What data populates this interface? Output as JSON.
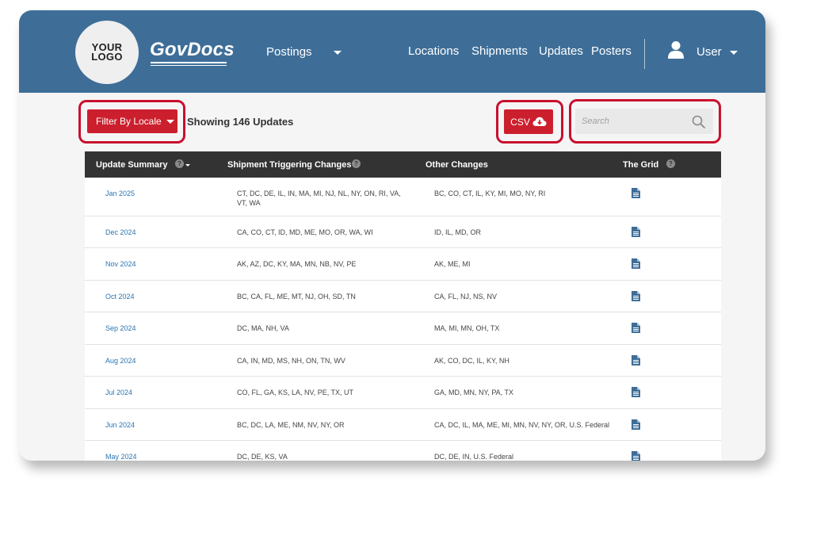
{
  "header": {
    "logo_line1": "YOUR",
    "logo_line2": "LOGO",
    "brand": "GovDocs",
    "postings_label": "Postings",
    "nav": [
      "Locations",
      "Shipments",
      "Updates",
      "Posters"
    ],
    "user_label": "User"
  },
  "toolbar": {
    "filter_label": "Filter By Locale",
    "showing_text": "Showing 146 Updates",
    "csv_label": "CSV",
    "search_placeholder": "Search"
  },
  "table": {
    "columns": [
      "Update Summary",
      "Shipment Triggering Changes",
      "Other Changes",
      "The Grid"
    ],
    "rows": [
      {
        "date": "Jan 2025",
        "triggering": "CT, DC, DE, IL, IN, MA, MI, NJ, NL, NY, ON, RI, VA, VT, WA",
        "other": "BC, CO, CT, IL, KY, MI, MO, NY, RI"
      },
      {
        "date": "Dec 2024",
        "triggering": "CA, CO, CT, ID, MD, ME, MO, OR, WA, WI",
        "other": "ID, IL, MD, OR"
      },
      {
        "date": "Nov 2024",
        "triggering": "AK, AZ, DC, KY, MA, MN, NB, NV, PE",
        "other": "AK, ME, MI"
      },
      {
        "date": "Oct 2024",
        "triggering": "BC, CA, FL, ME, MT, NJ, OH, SD, TN",
        "other": "CA, FL, NJ, NS, NV"
      },
      {
        "date": "Sep 2024",
        "triggering": "DC, MA, NH, VA",
        "other": "MA, MI, MN, OH, TX"
      },
      {
        "date": "Aug 2024",
        "triggering": "CA, IN, MD, MS, NH, ON, TN, WV",
        "other": "AK, CO, DC, IL, KY, NH"
      },
      {
        "date": "Jul 2024",
        "triggering": "CO, FL, GA, KS, LA, NV, PE, TX, UT",
        "other": "GA, MD, MN, NY, PA, TX"
      },
      {
        "date": "Jun 2024",
        "triggering": "BC, DC, LA, ME, NM, NV, NY, OR",
        "other": "CA, DC, IL, MA, ME, MI, MN, NV, NY, OR, U.S. Federal"
      },
      {
        "date": "May 2024",
        "triggering": "DC, DE, KS, VA",
        "other": "DC, DE, IN, U.S. Federal"
      }
    ]
  },
  "colors": {
    "header_bg": "#3e6e98",
    "accent_red": "#cc1f2d",
    "table_header_bg": "#333333",
    "link_blue": "#2a75b3"
  }
}
